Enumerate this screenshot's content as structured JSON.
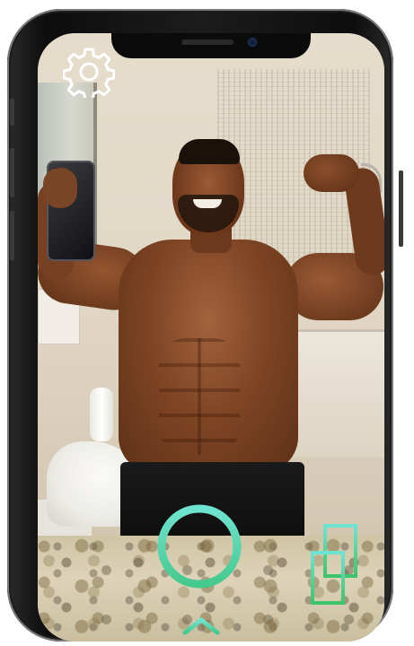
{
  "app": {
    "screen": "camera-viewfinder"
  },
  "icons": {
    "settings": "gear-icon",
    "shutter": "shutter-ring-icon",
    "gallery": "gallery-stack-icon",
    "expand": "chevron-up-icon"
  },
  "colors": {
    "accent_top": "#6fe3d1",
    "accent_bottom": "#45c98d",
    "icon_white": "#ffffff",
    "device_frame": "#111111"
  }
}
